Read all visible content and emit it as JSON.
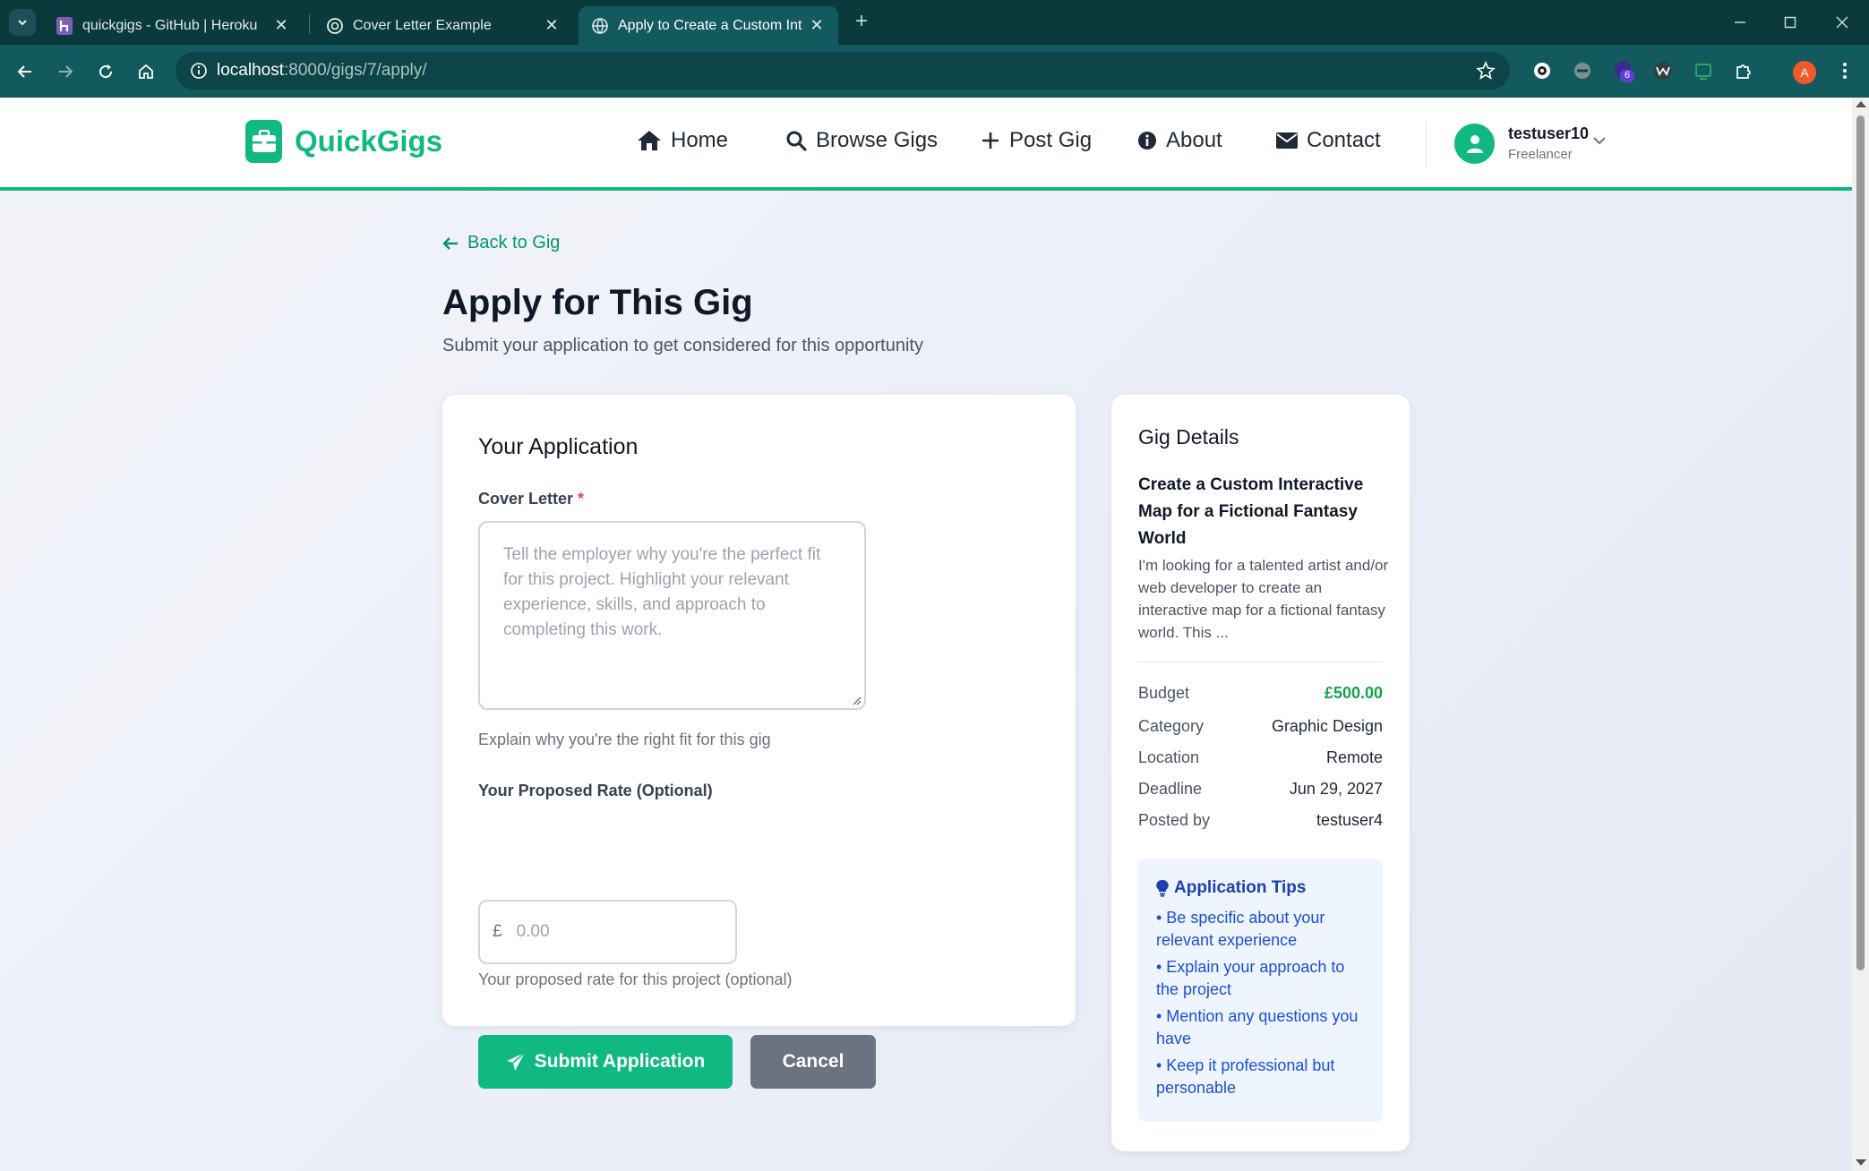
{
  "browser": {
    "tabs": [
      {
        "title": "quickgigs - GitHub | Heroku"
      },
      {
        "title": "Cover Letter Example"
      },
      {
        "title": "Apply to Create a Custom Intera"
      }
    ],
    "url_host": "localhost",
    "url_path": ":8000/gigs/7/apply/",
    "extension_badge": "6",
    "profile_initial": "A"
  },
  "site": {
    "brand": "QuickGigs",
    "nav": {
      "home": "Home",
      "browse": "Browse Gigs",
      "post": "Post Gig",
      "about": "About",
      "contact": "Contact"
    },
    "user": {
      "name": "testuser10",
      "role": "Freelancer"
    }
  },
  "page": {
    "back_link": "Back to Gig",
    "title": "Apply for This Gig",
    "subtitle": "Submit your application to get considered for this opportunity"
  },
  "application": {
    "heading": "Your Application",
    "cover_letter_label": "Cover Letter",
    "required_mark": "*",
    "cover_letter_placeholder": "Tell the employer why you're the perfect fit for this project. Highlight your relevant experience, skills, and approach to completing this work.",
    "cover_letter_help": "Explain why you're the right fit for this gig",
    "rate_label": "Your Proposed Rate (Optional)",
    "currency_symbol": "£",
    "rate_placeholder": "0.00",
    "rate_help": "Your proposed rate for this project (optional)",
    "submit_label": "Submit Application",
    "cancel_label": "Cancel"
  },
  "gig": {
    "heading": "Gig Details",
    "title": "Create a Custom Interactive Map for a Fictional Fantasy World",
    "description": "I'm looking for a talented artist and/or web developer to create an interactive map for a fictional fantasy world. This ...",
    "details": {
      "budget_label": "Budget",
      "budget": "£500.00",
      "category_label": "Category",
      "category": "Graphic Design",
      "location_label": "Location",
      "location": "Remote",
      "deadline_label": "Deadline",
      "deadline": "Jun 29, 2027",
      "posted_by_label": "Posted by",
      "posted_by": "testuser4"
    },
    "tips_heading": "Application Tips",
    "tips": [
      "• Be specific about your relevant experience",
      "• Explain your approach to the project",
      "• Mention any questions you have",
      "• Keep it professional but personable"
    ]
  },
  "colors": {
    "brand_green": "#10b981",
    "browser_chrome": "#125a5e",
    "tips_text": "#1d4ed8",
    "budget_green": "#16a34a",
    "cancel_gray": "#6b7280"
  }
}
